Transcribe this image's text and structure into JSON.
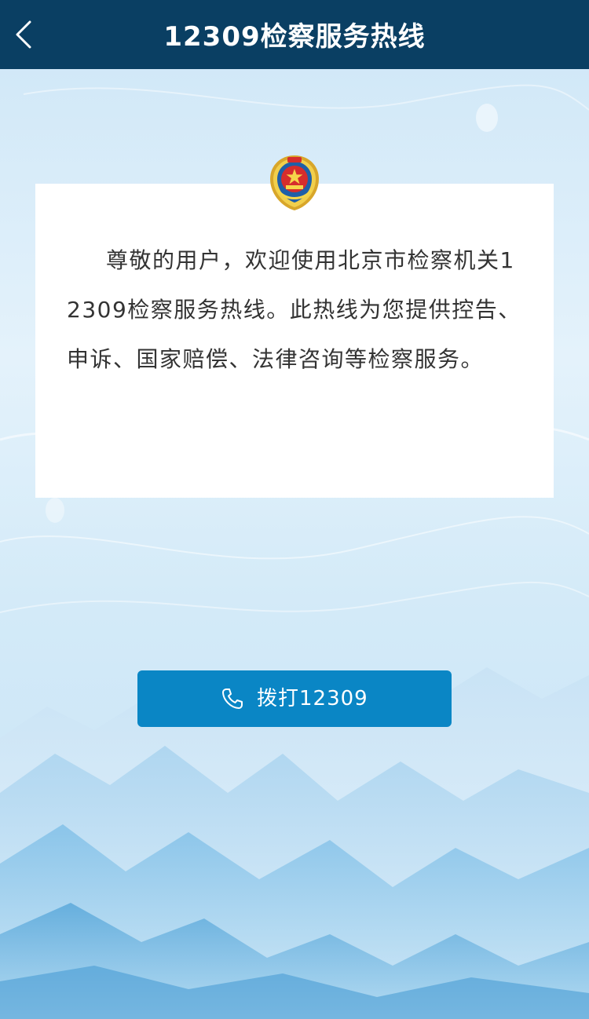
{
  "header": {
    "title": "12309检察服务热线",
    "back_icon": "chevron-left-icon"
  },
  "card": {
    "emblem_icon": "procuratorate-emblem-icon",
    "welcome_text": "尊敬的用户，欢迎使用北京市检察机关12309检察服务热线。此热线为您提供控告、申诉、国家赔偿、法律咨询等检察服务。"
  },
  "call_button": {
    "label": "拨打12309",
    "icon": "phone-icon"
  },
  "colors": {
    "header_bg": "#0a3f63",
    "button_bg": "#0a86c5",
    "page_bg": "#dbeefb",
    "text": "#333333"
  }
}
